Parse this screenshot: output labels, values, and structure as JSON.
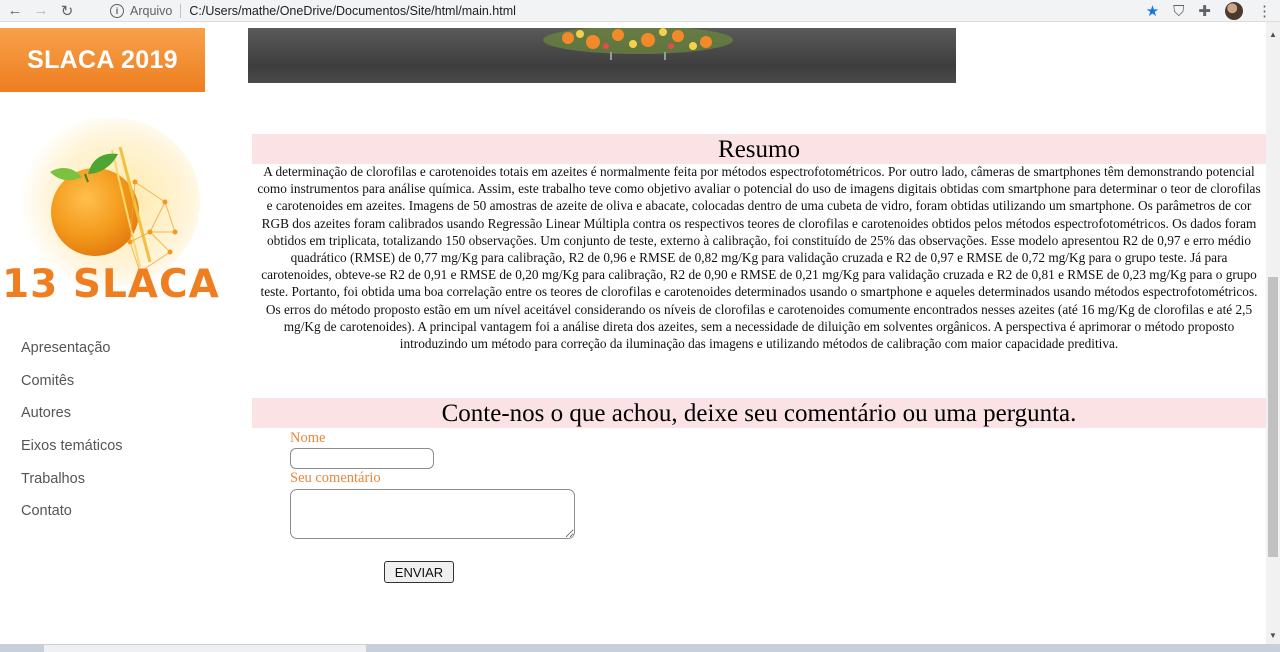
{
  "browser": {
    "scheme_label": "Arquivo",
    "url": "C:/Users/mathe/OneDrive/Documentos/Site/html/main.html"
  },
  "sidebar": {
    "brand": "SLACA 2019",
    "logo_text": "13 SLACA",
    "items": [
      {
        "label": "Apresentação"
      },
      {
        "label": "Comitês"
      },
      {
        "label": "Autores"
      },
      {
        "label": "Eixos temáticos"
      },
      {
        "label": "Trabalhos"
      },
      {
        "label": "Contato"
      }
    ]
  },
  "resumo": {
    "title": "Resumo",
    "text": "A determinação de clorofilas e carotenoides totais em azeites é normalmente feita por métodos espectrofotométricos. Por outro lado, câmeras de smartphones têm demonstrando potencial como instrumentos para análise química. Assim, este trabalho teve como objetivo avaliar o potencial do uso de imagens digitais obtidas com smartphone para determinar o teor de clorofilas e carotenoides em azeites. Imagens de 50 amostras de azeite de oliva e abacate, colocadas dentro de uma cubeta de vidro, foram obtidas utilizando um smartphone. Os parâmetros de cor RGB dos azeites foram calibrados usando Regressão Linear Múltipla contra os respectivos teores de clorofilas e carotenoides obtidos pelos métodos espectrofotométricos. Os dados foram obtidos em triplicata, totalizando 150 observações. Um conjunto de teste, externo à calibração, foi constituído de 25% das observações. Esse modelo apresentou R2 de 0,97 e erro médio quadrático (RMSE) de 0,77 mg/Kg para calibração, R2 de 0,96 e RMSE de 0,82 mg/Kg para validação cruzada e R2 de 0,97 e RMSE de 0,72 mg/Kg para o grupo teste. Já para carotenoides, obteve-se R2 de 0,91 e RMSE de 0,20 mg/Kg para calibração, R2 de 0,90 e RMSE de 0,21 mg/Kg para validação cruzada e R2 de 0,81 e RMSE de 0,23 mg/Kg para o grupo teste. Portanto, foi obtida uma boa correlação entre os teores de clorofilas e carotenoides determinados usando o smartphone e aqueles determinados usando métodos espectrofotométricos. Os erros do método proposto estão em um nível aceitável considerando os níveis de clorofilas e carotenoides comumente encontrados nesses azeites (até 16 mg/Kg de clorofilas e até 2,5 mg/Kg de carotenoides). A principal vantagem foi a análise direta dos azeites, sem a necessidade de diluição em solventes orgânicos. A perspectiva é aprimorar o método proposto introduzindo um método para correção da iluminação das imagens e utilizando métodos de calibração com maior capacidade preditiva."
  },
  "comments": {
    "title": "Conte-nos o que achou, deixe seu comentário ou uma pergunta.",
    "name_label": "Nome",
    "name_value": "",
    "comment_label": "Seu comentário",
    "comment_value": "",
    "submit_label": "ENVIAR"
  },
  "colors": {
    "accent": "#ee7e1f",
    "section_bg": "#fbe3e5",
    "label": "#e8873a"
  },
  "icons": [
    "back-arrow-icon",
    "forward-arrow-icon",
    "reload-icon",
    "info-icon",
    "star-icon",
    "shield-icon",
    "puzzle-icon",
    "kebab-menu-icon"
  ]
}
